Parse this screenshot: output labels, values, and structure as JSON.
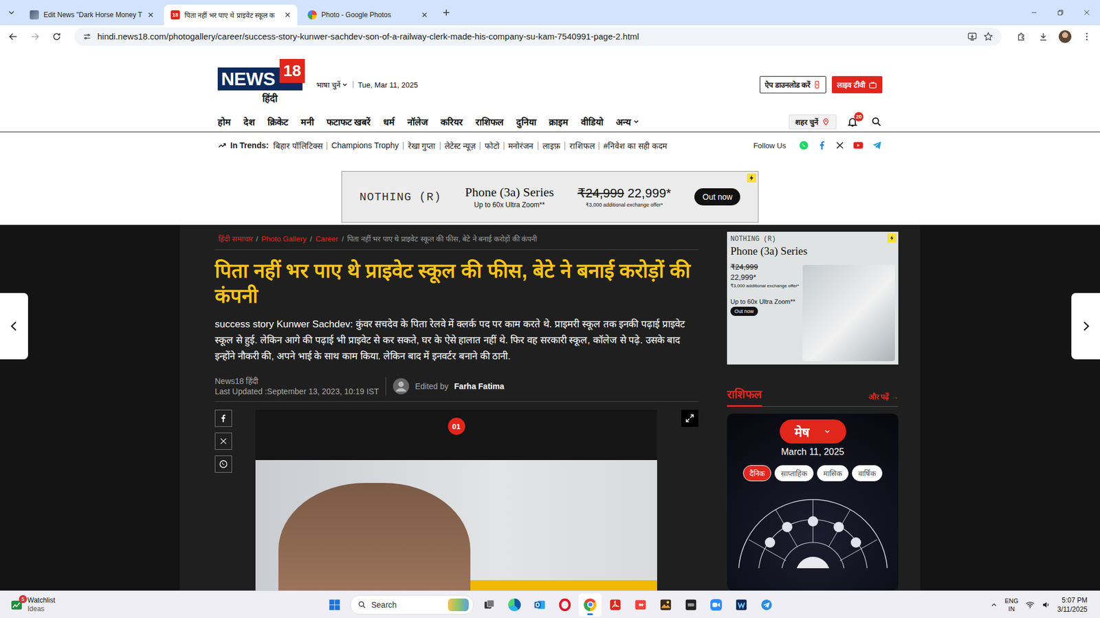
{
  "browser": {
    "tabs": [
      {
        "title": "Edit News \"Dark Horse Money T",
        "kind": "thumb",
        "selected": false
      },
      {
        "title": "पिता नहीं भर पाए थे प्राइवेट स्कूल क",
        "kind": "news18",
        "badge": "18",
        "selected": true
      },
      {
        "title": "Photo - Google Photos",
        "kind": "photos",
        "selected": false
      }
    ],
    "url": "hindi.news18.com/photogallery/career/success-story-kunwer-sachdev-son-of-a-railway-clerk-made-his-company-su-kam-7540991-page-2.html"
  },
  "site": {
    "logo": {
      "main": "NEWS",
      "badge": "18",
      "sub": "हिंदी"
    },
    "language": "भाषा चुनें",
    "date": "Tue, Mar 11, 2025",
    "app_download": "ऐप डाउनलोड करें",
    "live_tv": "लाइव टीवी",
    "nav": [
      {
        "label": "होम",
        "has_menu": false
      },
      {
        "label": "देश",
        "has_menu": false
      },
      {
        "label": "क्रिकेट",
        "has_menu": false
      },
      {
        "label": "मनी",
        "has_menu": false
      },
      {
        "label": "फटाफट खबरें",
        "has_menu": false
      },
      {
        "label": "धर्म",
        "has_menu": false
      },
      {
        "label": "नॉलेज",
        "has_menu": false
      },
      {
        "label": "करियर",
        "has_menu": false
      },
      {
        "label": "राशिफल",
        "has_menu": false
      },
      {
        "label": "दुनिया",
        "has_menu": false
      },
      {
        "label": "क्राइम",
        "has_menu": false
      },
      {
        "label": "वीडियो",
        "has_menu": false
      },
      {
        "label": "अन्य",
        "has_menu": true
      }
    ],
    "city": "शहर चुनें",
    "notifications": "20",
    "trends_label": "In Trends:",
    "trends": [
      "बिहार पॉलिटिक्स",
      "Champions Trophy",
      "रेखा गुप्ता",
      "लेटेस्ट न्यूज़",
      "फोटो",
      "मनोरंजन",
      "लाइफ़",
      "राशिफल",
      "#निवेश का सही कदम"
    ],
    "separator": "|",
    "follow_label": "Follow Us",
    "social": [
      {
        "kind": "whatsapp",
        "color": "#25d366"
      },
      {
        "kind": "facebook",
        "color": "#1877f2"
      },
      {
        "kind": "x",
        "color": "#111111"
      },
      {
        "kind": "youtube",
        "color": "#e62117"
      },
      {
        "kind": "telegram",
        "color": "#229ed9"
      }
    ]
  },
  "top_ad": {
    "brand": "NOTHING (R)",
    "title": "Phone (3a) Series",
    "subtitle": "Up to 60x Ultra Zoom**",
    "old_price": "₹24,999",
    "price": "22,999*",
    "offer": "₹3,000 additional exchange offer*",
    "cta": "Out now"
  },
  "article": {
    "breadcrumb": [
      {
        "label": "हिंदी समाचार",
        "current": false
      },
      {
        "label": "Photo Gallery",
        "current": false
      },
      {
        "label": "Career",
        "current": false
      },
      {
        "label": "पिता नहीं भर पाए थे प्राइवेट स्कूल की फीस, बेटे ने बनाई करोड़ों की कंपनी",
        "current": true
      }
    ],
    "breadcrumb_separator": "/",
    "headline": "पिता नहीं भर पाए थे प्राइवेट स्कूल की फीस, बेटे ने बनाई करोड़ों की कंपनी",
    "summary": "success story Kunwer Sachdev: कुंवर सचदेव के पिता रेलवे में क्लर्क पद पर काम करते थे. प्राइमरी स्कूल तक इनकी पढ़ाई प्राइवेट स्कूल से हुई. लेकिन आगे की पढ़ाई भी प्राइवेट से कर सकते, घर के ऐसे हालात नहीं थे. फिर वह सरकारी स्कूल, कॉलेज से पढ़े. उसके बाद इन्होंने नौकरी की, अपने भाई के साथ काम किया. लेकिन बाद में इनवर्टर बनाने की ठानी.",
    "source": "News18 हिंदी",
    "updated": "Last Updated :September 13, 2023, 10:19 IST",
    "edited_label": "Edited by",
    "editor": "Farha Fatima",
    "share": [
      {
        "kind": "facebook"
      },
      {
        "kind": "x"
      },
      {
        "kind": "whatsapp"
      }
    ],
    "slide": "01"
  },
  "side_ad": {
    "brand": "NOTHING (R)",
    "title": "Phone (3a) Series",
    "old_price": "₹24,999",
    "price": "22,999*",
    "offer": "₹3,000 additional exchange offer*",
    "zoom": "Up to 60x Ultra Zoom**",
    "cta": "Out now"
  },
  "horoscope": {
    "title": "राशिफल",
    "more": "और पढ़ें",
    "more_arrow": "→",
    "sign": "मेष",
    "date": "March 11, 2025",
    "periods": [
      {
        "label": "दैनिक",
        "selected": true
      },
      {
        "label": "साप्ताहिक",
        "selected": false
      },
      {
        "label": "मासिक",
        "selected": false
      },
      {
        "label": "वार्षिक",
        "selected": false
      }
    ]
  },
  "taskbar": {
    "widget": {
      "badge": "5",
      "title": "Watchlist",
      "subtitle": "Ideas"
    },
    "search": "Search",
    "apps": [
      {
        "kind": "taskview",
        "selected": false
      },
      {
        "kind": "edge",
        "selected": false
      },
      {
        "kind": "outlook",
        "selected": false
      },
      {
        "kind": "opera",
        "selected": false
      },
      {
        "kind": "chrome",
        "selected": true
      },
      {
        "kind": "acrobat",
        "selected": false
      },
      {
        "kind": "anydesk",
        "selected": false
      },
      {
        "kind": "photo",
        "selected": false
      },
      {
        "kind": "dark",
        "selected": false
      },
      {
        "kind": "zoom",
        "selected": false
      },
      {
        "kind": "navy",
        "selected": false
      },
      {
        "kind": "plane",
        "selected": false
      }
    ],
    "language": "ENG",
    "region": "IN",
    "time": "5:07 PM",
    "date": "3/11/2025"
  }
}
